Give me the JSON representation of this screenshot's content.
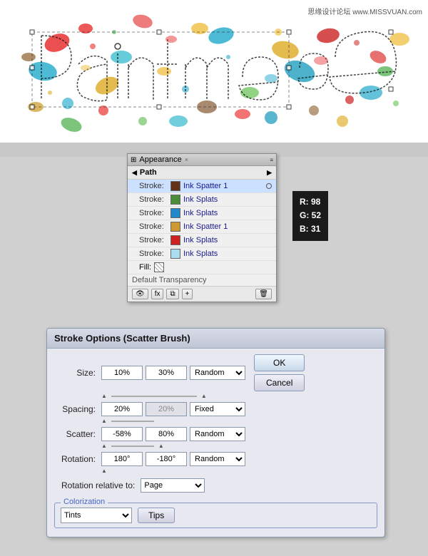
{
  "watermark": "思缘设计论坛 www.MISSVUAN.com",
  "appearance_panel": {
    "title": "Appearance",
    "close": "×",
    "path_label": "Path",
    "rows": [
      {
        "label": "Stroke:",
        "color": "#623118",
        "name": "Ink Spatter 1",
        "highlight": true
      },
      {
        "label": "Stroke:",
        "color": "#4a8c3c",
        "name": "Ink Splats",
        "highlight": false
      },
      {
        "label": "Stroke:",
        "color": "#2288cc",
        "name": "Ink Splats",
        "highlight": false
      },
      {
        "label": "Stroke:",
        "color": "#cc9933",
        "name": "Ink Spatter 1",
        "highlight": false
      },
      {
        "label": "Stroke:",
        "color": "#cc2222",
        "name": "Ink Splats",
        "highlight": false
      },
      {
        "label": "Stroke:",
        "color": "#aaddee",
        "name": "Ink Splats",
        "highlight": false
      }
    ],
    "fill_label": "Fill:",
    "default_transparency": "Default Transparency"
  },
  "color_tooltip": {
    "r": "R: 98",
    "g": "G: 52",
    "b": "B: 31"
  },
  "stroke_options": {
    "title": "Stroke Options (Scatter Brush)",
    "size_label": "Size:",
    "size_val1": "10%",
    "size_val2": "30%",
    "size_dropdown": "Random",
    "spacing_label": "Spacing:",
    "spacing_val1": "20%",
    "spacing_val2": "20%",
    "spacing_dropdown": "Fixed",
    "scatter_label": "Scatter:",
    "scatter_val1": "-58%",
    "scatter_val2": "80%",
    "scatter_dropdown": "Random",
    "rotation_label": "Rotation:",
    "rotation_val1": "180°",
    "rotation_val2": "-180°",
    "rotation_dropdown": "Random",
    "rotation_relative_label": "Rotation relative to:",
    "rotation_relative_dropdown": "Page",
    "ok_label": "OK",
    "cancel_label": "Cancel",
    "colorization_legend": "Colorization",
    "colorization_dropdown": "Tints",
    "tips_label": "Tips"
  }
}
